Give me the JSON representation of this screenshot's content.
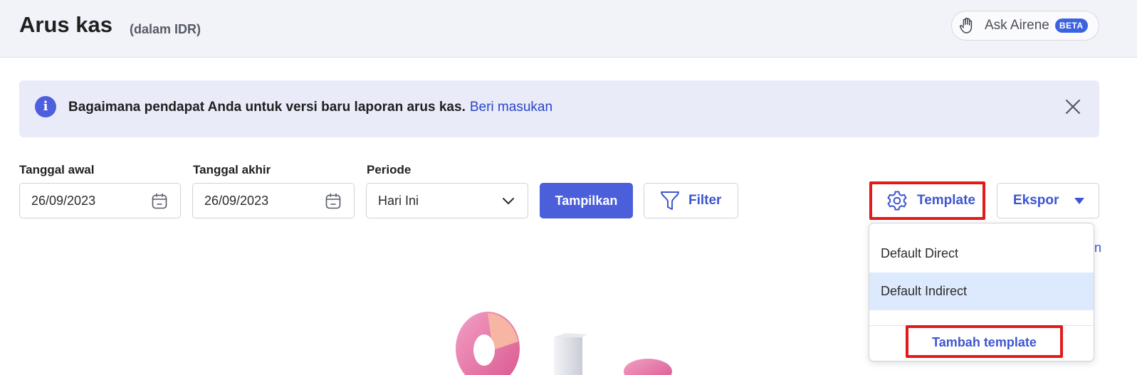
{
  "header": {
    "title": "Arus kas",
    "subtitle": "(dalam IDR)",
    "assistant": {
      "label": "Ask Airene",
      "badge": "BETA"
    }
  },
  "banner": {
    "message": "Bagaimana pendapat Anda untuk versi baru laporan arus kas.",
    "link_label": "Beri masukan"
  },
  "filters": {
    "start_date": {
      "label": "Tanggal awal",
      "value": "26/09/2023"
    },
    "end_date": {
      "label": "Tanggal akhir",
      "value": "26/09/2023"
    },
    "period": {
      "label": "Periode",
      "value": "Hari Ini"
    }
  },
  "toolbar": {
    "show_label": "Tampilkan",
    "filter_label": "Filter",
    "template_label": "Template",
    "export_label": "Ekspor"
  },
  "template_menu": {
    "items": [
      {
        "label": "Default Direct"
      },
      {
        "label": "Default Indirect"
      }
    ],
    "add_label": "Tambah template"
  },
  "partial_link_fragment": "n",
  "colors": {
    "primary": "#4a5fd9",
    "link": "#3d55d0",
    "highlight_box": "#e21a1a",
    "banner_bg": "#e9ebf9",
    "selected_item_bg": "#dde9fc"
  }
}
